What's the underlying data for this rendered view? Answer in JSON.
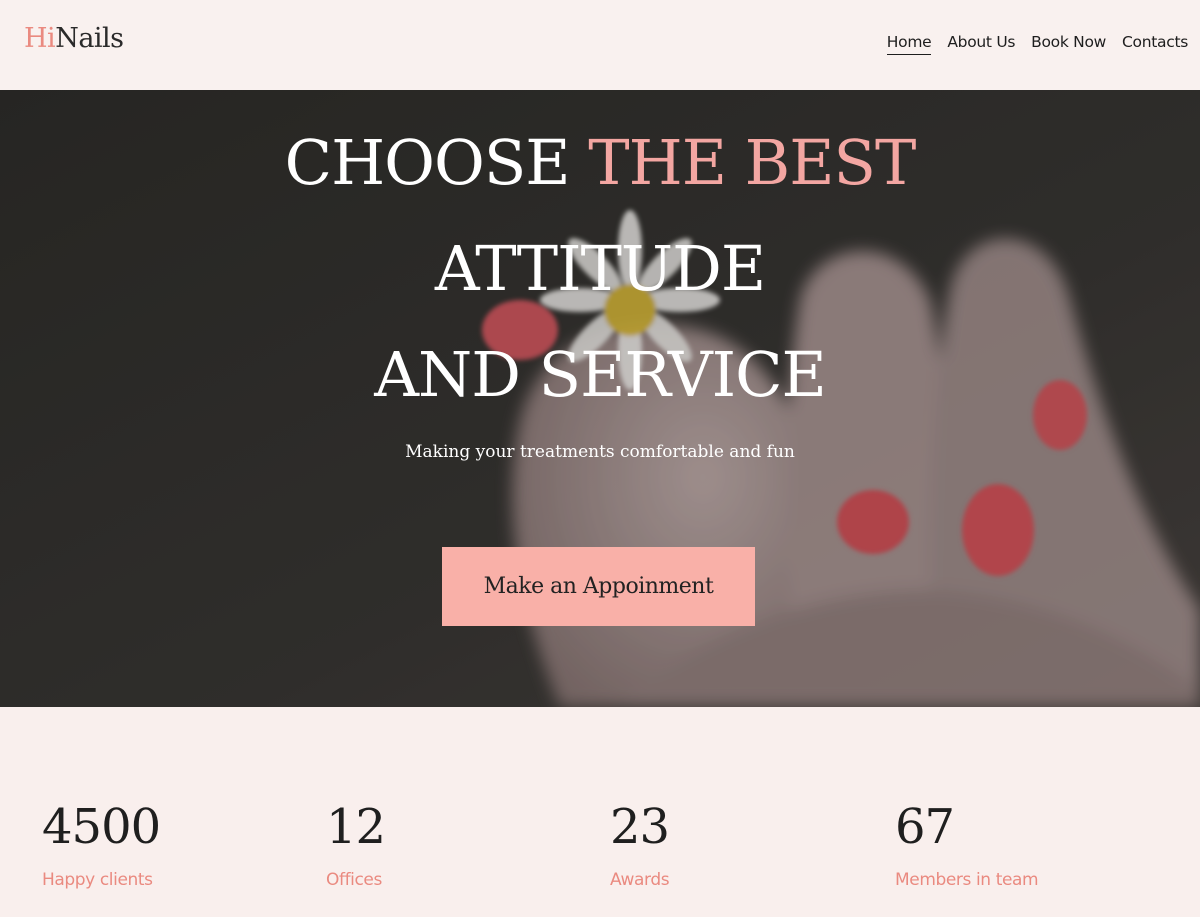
{
  "brand": {
    "logo_prefix": "Hi",
    "logo_suffix": "Nails",
    "accent_color": "#ea8a80",
    "button_color": "#f9b0a8"
  },
  "nav": {
    "items": [
      {
        "label": "Home"
      },
      {
        "label": "About Us"
      },
      {
        "label": "Book Now"
      },
      {
        "label": "Contacts"
      }
    ]
  },
  "hero": {
    "title_part1": "CHOOSE ",
    "title_highlight": "THE BEST",
    "title_line2": "ATTITUDE",
    "title_line3": "AND SERVICE",
    "subtitle": "Making your treatments comfortable and fun",
    "cta_label": "Make an Appoinment"
  },
  "stats": [
    {
      "value": "4500",
      "label": "Happy clients"
    },
    {
      "value": "12",
      "label": "Offices"
    },
    {
      "value": "23",
      "label": "Awards"
    },
    {
      "value": "67",
      "label": "Members in team"
    }
  ]
}
